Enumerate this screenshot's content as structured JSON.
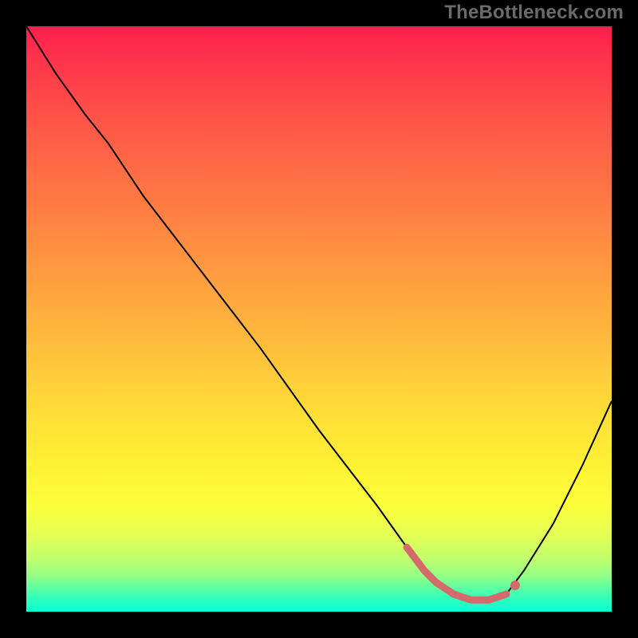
{
  "watermark": "TheBottleneck.com",
  "colors": {
    "frame_bg": "#000000",
    "curve": "#000000",
    "marker": "#d46a6a"
  },
  "chart_data": {
    "type": "line",
    "title": "",
    "xlabel": "",
    "ylabel": "",
    "xlim": [
      0,
      100
    ],
    "ylim": [
      0,
      100
    ],
    "grid": false,
    "background": "rainbow-gradient",
    "series": [
      {
        "name": "bottleneck-curve",
        "x": [
          0,
          5,
          10,
          14,
          20,
          30,
          40,
          50,
          60,
          65,
          68,
          70,
          73,
          76,
          79,
          82,
          85,
          90,
          95,
          100
        ],
        "values": [
          100,
          92,
          85,
          80,
          71,
          58,
          45,
          31,
          18,
          11,
          7,
          5,
          3,
          2,
          2,
          3,
          7,
          15,
          25,
          36
        ]
      }
    ],
    "markers": [
      {
        "name": "optimal-region",
        "x": [
          65,
          68,
          70,
          73,
          76,
          79,
          82
        ],
        "values": [
          11,
          7,
          5,
          3,
          2,
          2,
          3
        ]
      },
      {
        "name": "optimal-dot",
        "x": 83.5,
        "value": 4.5
      }
    ]
  }
}
